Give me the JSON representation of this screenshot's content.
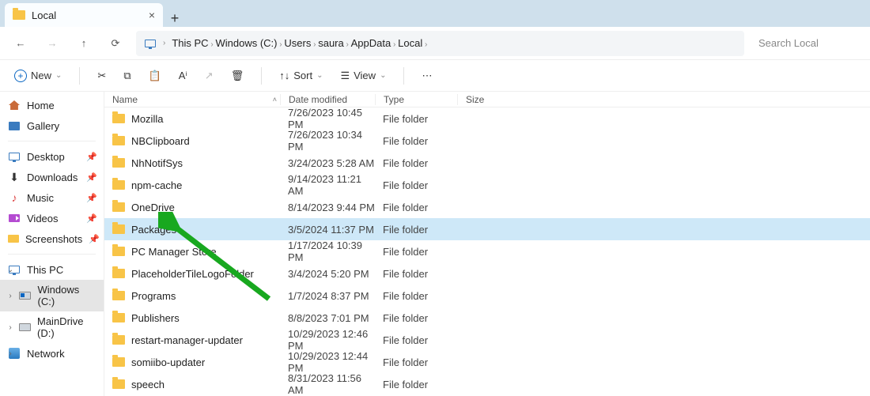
{
  "tab": {
    "title": "Local"
  },
  "breadcrumbs": [
    "This PC",
    "Windows (C:)",
    "Users",
    "saura",
    "AppData",
    "Local"
  ],
  "search": {
    "placeholder": "Search Local"
  },
  "toolbar": {
    "new": "New",
    "sort": "Sort",
    "view": "View"
  },
  "columns": {
    "name": "Name",
    "date": "Date modified",
    "type": "Type",
    "size": "Size"
  },
  "sidebar": {
    "top": [
      {
        "label": "Home",
        "icon": "home"
      },
      {
        "label": "Gallery",
        "icon": "gallery"
      }
    ],
    "quick": [
      {
        "label": "Desktop",
        "icon": "monitor"
      },
      {
        "label": "Downloads",
        "icon": "dl"
      },
      {
        "label": "Music",
        "icon": "music"
      },
      {
        "label": "Videos",
        "icon": "video"
      },
      {
        "label": "Screenshots",
        "icon": "cam"
      }
    ],
    "drives_header": "This PC",
    "drives": [
      {
        "label": "Windows (C:)",
        "icon": "drive win",
        "sel": true
      },
      {
        "label": "MainDrive (D:)",
        "icon": "drive"
      }
    ],
    "network": "Network"
  },
  "files": [
    {
      "name": "Mozilla",
      "date": "7/26/2023 10:45 PM",
      "type": "File folder"
    },
    {
      "name": "NBClipboard",
      "date": "7/26/2023 10:34 PM",
      "type": "File folder"
    },
    {
      "name": "NhNotifSys",
      "date": "3/24/2023 5:28 AM",
      "type": "File folder"
    },
    {
      "name": "npm-cache",
      "date": "9/14/2023 11:21 AM",
      "type": "File folder"
    },
    {
      "name": "OneDrive",
      "date": "8/14/2023 9:44 PM",
      "type": "File folder"
    },
    {
      "name": "Packages",
      "date": "3/5/2024 11:37 PM",
      "type": "File folder",
      "selected": true
    },
    {
      "name": "PC Manager Store",
      "date": "1/17/2024 10:39 PM",
      "type": "File folder"
    },
    {
      "name": "PlaceholderTileLogoFolder",
      "date": "3/4/2024 5:20 PM",
      "type": "File folder"
    },
    {
      "name": "Programs",
      "date": "1/7/2024 8:37 PM",
      "type": "File folder"
    },
    {
      "name": "Publishers",
      "date": "8/8/2023 7:01 PM",
      "type": "File folder"
    },
    {
      "name": "restart-manager-updater",
      "date": "10/29/2023 12:46 PM",
      "type": "File folder"
    },
    {
      "name": "somiibo-updater",
      "date": "10/29/2023 12:44 PM",
      "type": "File folder"
    },
    {
      "name": "speech",
      "date": "8/31/2023 11:56 AM",
      "type": "File folder"
    }
  ]
}
